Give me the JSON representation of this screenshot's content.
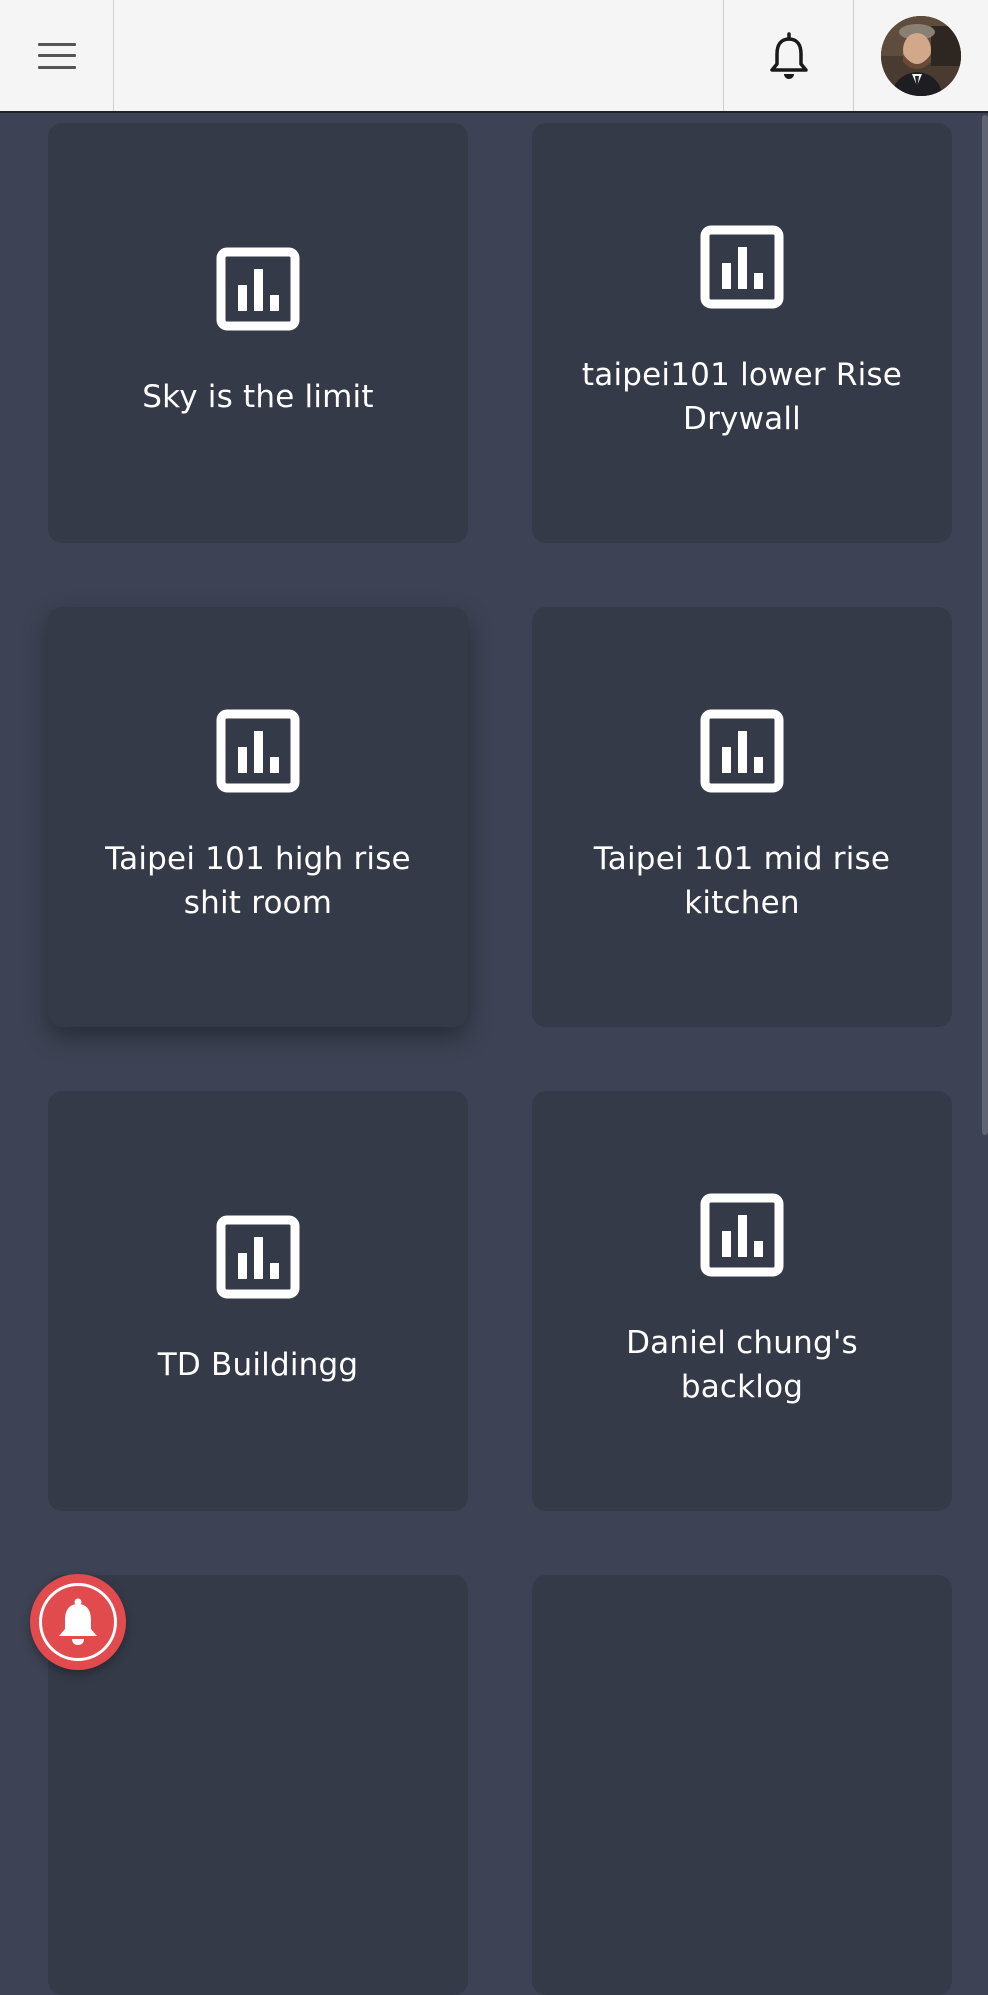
{
  "header": {
    "menu_icon": "hamburger-menu-icon",
    "bell_icon": "notification-bell-icon",
    "avatar_alt": "user-avatar"
  },
  "boards": [
    {
      "title": "Sky is the limit",
      "icon": "bar-chart-icon"
    },
    {
      "title": "taipei101 lower Rise Drywall",
      "icon": "bar-chart-icon"
    },
    {
      "title": "Taipei 101 high rise shit room",
      "icon": "bar-chart-icon"
    },
    {
      "title": "Taipei 101 mid rise kitchen",
      "icon": "bar-chart-icon"
    },
    {
      "title": "TD Buildingg",
      "icon": "bar-chart-icon"
    },
    {
      "title": "Daniel chung's backlog",
      "icon": "bar-chart-icon"
    },
    {
      "title": "",
      "icon": ""
    },
    {
      "title": "",
      "icon": ""
    }
  ],
  "fab": {
    "icon": "notification-bell-icon",
    "color": "#e14b4e"
  },
  "colors": {
    "background": "#3d4354",
    "card": "#353a48",
    "header": "#f5f5f5"
  }
}
